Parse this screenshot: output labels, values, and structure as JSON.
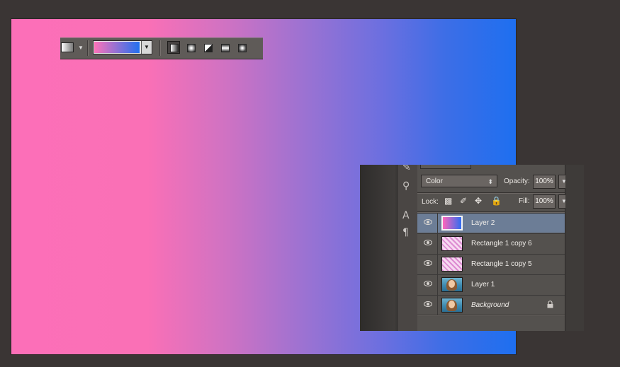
{
  "colors": {
    "background": "#3a3534",
    "gradient_start": "#fc6fb8",
    "gradient_end": "#1e6ff0",
    "selection": "#6c7d96"
  },
  "options_bar": {
    "preset_icon": "gradient-preset-icon",
    "picker_icon": "gradient-picker-swatch",
    "gradient_types": [
      {
        "name": "linear-gradient-icon",
        "active": true
      },
      {
        "name": "radial-gradient-icon",
        "active": false
      },
      {
        "name": "angle-gradient-icon",
        "active": false
      },
      {
        "name": "reflected-gradient-icon",
        "active": false
      },
      {
        "name": "diamond-gradient-icon",
        "active": false
      }
    ]
  },
  "layers_panel": {
    "blend_mode": "Color",
    "opacity_label": "Opacity:",
    "opacity_value": "100%",
    "lock_label": "Lock:",
    "fill_label": "Fill:",
    "fill_value": "100%",
    "lock_icons": [
      "lock-transparent-icon",
      "lock-paint-icon",
      "lock-move-icon",
      "lock-all-icon"
    ],
    "layers": [
      {
        "name": "Layer 2",
        "selected": true,
        "thumb": "gradient",
        "italic": false,
        "locked": false
      },
      {
        "name": "Rectangle 1 copy 6",
        "selected": false,
        "thumb": "pattern",
        "italic": false,
        "locked": false
      },
      {
        "name": "Rectangle 1 copy 5",
        "selected": false,
        "thumb": "pattern",
        "italic": false,
        "locked": false
      },
      {
        "name": "Layer 1",
        "selected": false,
        "thumb": "photo",
        "italic": false,
        "locked": false
      },
      {
        "name": "Background",
        "selected": false,
        "thumb": "photo",
        "italic": true,
        "locked": true
      }
    ]
  },
  "tool_strip": {
    "items": [
      "brush-tool-icon",
      "smudge-tool-icon",
      "type-tool-icon",
      "paragraph-icon"
    ]
  }
}
